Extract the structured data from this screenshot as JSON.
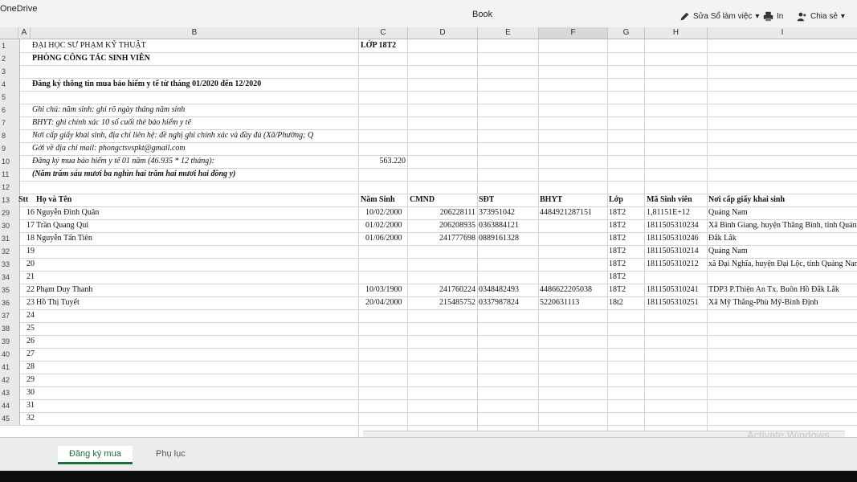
{
  "app": {
    "onedrive": "OneDrive",
    "title": "Book"
  },
  "toolbar": {
    "edit": "Sửa Sổ làm việc",
    "print": "In",
    "share": "Chia sẻ"
  },
  "columns": [
    "A",
    "B",
    "C",
    "D",
    "E",
    "F",
    "G",
    "H",
    "I"
  ],
  "header_rows": [
    {
      "num": "1",
      "b": "ĐẠI HỌC SƯ PHẠM KỸ THUẬT",
      "c": "LỚP 18T2"
    },
    {
      "num": "2",
      "b": "PHÒNG CÔNG TÁC SINH VIÊN"
    },
    {
      "num": "3"
    },
    {
      "num": "4",
      "b": "Đăng ký thông tin mua bảo hiểm y tế từ tháng 01/2020 đến 12/2020"
    },
    {
      "num": "5"
    },
    {
      "num": "6",
      "b": "Ghi chú: năm sinh: ghi rõ ngày tháng năm sinh"
    },
    {
      "num": "7",
      "b": "BHYT: ghi chính xác 10 số cuối thẻ bảo hiểm y tế"
    },
    {
      "num": "8",
      "b": "Nơi cấp giấy khai sinh, địa chỉ liên hệ: đề nghị ghi chính xác và đầy đủ (Xã/Phường; Q"
    },
    {
      "num": "9",
      "b": "Gởi về địa chỉ mail: phongctsvspkt@gmail.com"
    },
    {
      "num": "10",
      "b": "Đăng ký mua bảo hiểm y tế 01 năm (46.935 * 12 tháng):",
      "c": "563.220"
    },
    {
      "num": "11",
      "b": "(Năm trăm sáu mươi ba nghìn hai trăm hai mươi hai đồng y)"
    },
    {
      "num": "12"
    }
  ],
  "table_header": {
    "num": "13",
    "stt": "Stt",
    "name": "Họ và Tên",
    "dob": "Năm Sinh",
    "cmnd": "CMND",
    "sdt": "SĐT",
    "bhyt": "BHYT",
    "lop": "Lớp",
    "msv": "Mã Sinh viên",
    "noi": "Nơi cấp giấy khai sinh"
  },
  "students": [
    {
      "num": "29",
      "stt": "16",
      "name": "Nguyễn Đình Quân",
      "dob": "10/02/2000",
      "cmnd": "206228111",
      "sdt": "373951042",
      "bhyt": "4484921287151",
      "lop": "18T2",
      "msv": "1,81151E+12",
      "noi": "Quảng Nam"
    },
    {
      "num": "30",
      "stt": "17",
      "name": "Trần Quang Qui",
      "dob": "01/02/2000",
      "cmnd": "206208935",
      "sdt": "0363884121",
      "bhyt": "",
      "lop": "18T2",
      "msv": "1811505310234",
      "noi": "Xã Bình Giang, huyện Thăng Bình, tỉnh Quản"
    },
    {
      "num": "31",
      "stt": "18",
      "name": "Nguyễn Tấn Tiên",
      "dob": "01/06/2000",
      "cmnd": "241777698",
      "sdt": "0889161328",
      "bhyt": "",
      "lop": "18T2",
      "msv": "1811505310246",
      "noi": "Đắk Lắk"
    },
    {
      "num": "32",
      "stt": "19",
      "name": "",
      "dob": "",
      "cmnd": "",
      "sdt": "",
      "bhyt": "",
      "lop": "18T2",
      "msv": "1811505310214",
      "noi": "Quảng Nam"
    },
    {
      "num": "33",
      "stt": "20",
      "name": "",
      "dob": "",
      "cmnd": "",
      "sdt": "",
      "bhyt": "",
      "lop": "18T2",
      "msv": "1811505310212",
      "noi": "xã Đại Nghĩa, huyện Đại Lộc, tỉnh Quảng Nam"
    },
    {
      "num": "34",
      "stt": "21",
      "name": "",
      "dob": "",
      "cmnd": "",
      "sdt": "",
      "bhyt": "",
      "lop": "18T2",
      "msv": "",
      "noi": ""
    },
    {
      "num": "35",
      "stt": "22",
      "name": "Phạm Duy Thanh",
      "dob": "10/03/1900",
      "cmnd": "241760224",
      "sdt": "0348482493",
      "bhyt": "4486622205038",
      "lop": "18T2",
      "msv": "1811505310241",
      "noi": "TDP3 P.Thiện An Tx. Buôn Hồ Đắk Lắk"
    },
    {
      "num": "36",
      "stt": "23",
      "name": "Hồ Thị Tuyết",
      "dob": "20/04/2000",
      "cmnd": "215485752",
      "sdt": "0337987824",
      "bhyt": "5220631113",
      "lop": "18t2",
      "msv": "1811505310251",
      "noi": "Xã Mỹ Thắng-Phù Mỹ-Bình Định"
    }
  ],
  "empty_rows": [
    {
      "num": "37",
      "stt": "24"
    },
    {
      "num": "38",
      "stt": "25"
    },
    {
      "num": "39",
      "stt": "26"
    },
    {
      "num": "40",
      "stt": "27"
    },
    {
      "num": "41",
      "stt": "28"
    },
    {
      "num": "42",
      "stt": "29"
    },
    {
      "num": "43",
      "stt": "30"
    },
    {
      "num": "44",
      "stt": "31"
    },
    {
      "num": "45",
      "stt": "32"
    }
  ],
  "tabs": {
    "active": "Đăng ký mua",
    "other": "Phụ lục"
  },
  "watermark": "Activate Windows"
}
